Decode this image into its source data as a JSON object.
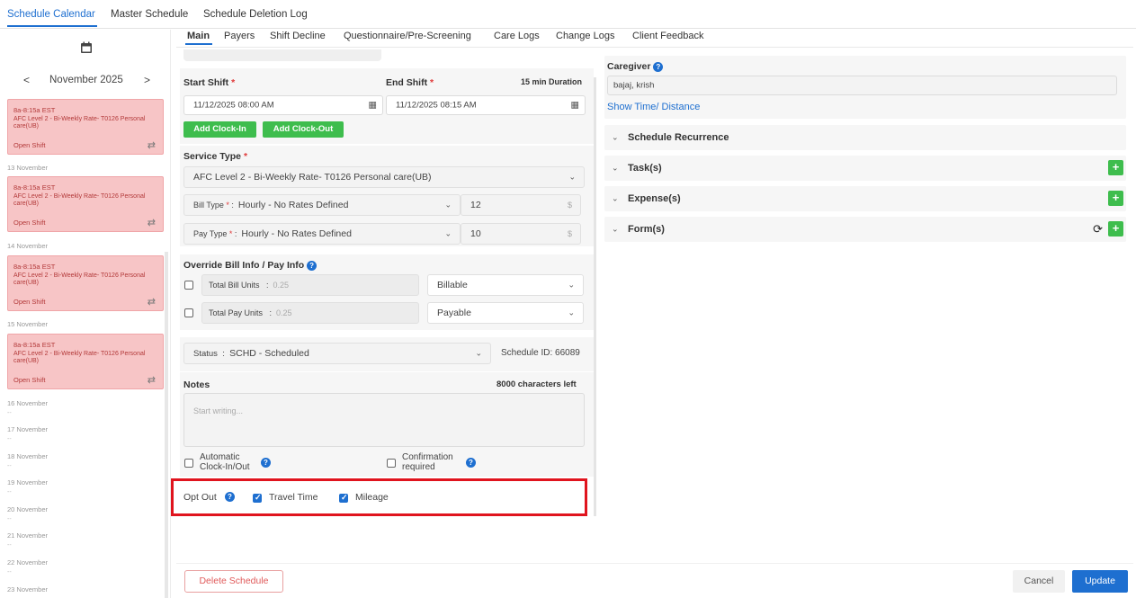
{
  "top_tabs": [
    "Schedule Calendar",
    "Master Schedule",
    "Schedule Deletion Log"
  ],
  "calendar": {
    "month": "November 2025",
    "prev": "<",
    "next": ">",
    "cards": [
      {
        "time": "8a-8:15a EST",
        "service": "AFC Level 2 - Bi-Weekly Rate- T0126 Personal care(UB)",
        "status": "Open Shift"
      },
      {
        "time": "8a-8:15a EST",
        "service": "AFC Level 2 - Bi-Weekly Rate- T0126 Personal care(UB)",
        "status": "Open Shift"
      },
      {
        "time": "8a-8:15a EST",
        "service": "AFC Level 2 - Bi-Weekly Rate- T0126 Personal care(UB)",
        "status": "Open Shift"
      },
      {
        "time": "8a-8:15a EST",
        "service": "AFC Level 2 - Bi-Weekly Rate- T0126 Personal care(UB)",
        "status": "Open Shift"
      }
    ],
    "day_labels": [
      "13 November",
      "14 November",
      "15 November",
      "16 November",
      "17 November",
      "18 November",
      "19 November",
      "20 November",
      "21 November",
      "22 November",
      "23 November"
    ],
    "empty_marker": "--"
  },
  "sub_tabs": [
    "Main",
    "Payers",
    "Shift Decline",
    "Questionnaire/Pre-Screening",
    "Care Logs",
    "Change Logs",
    "Client Feedback"
  ],
  "shift": {
    "start_label": "Start Shift",
    "end_label": "End Shift",
    "required_mark": "*",
    "duration": "15 min Duration",
    "start_value": "11/12/2025 08:00 AM",
    "end_value": "11/12/2025 08:15 AM",
    "clock_in": "Add Clock-In",
    "clock_out": "Add Clock-Out"
  },
  "service": {
    "label": "Service Type",
    "value": "AFC Level 2 - Bi-Weekly Rate- T0126 Personal care(UB)",
    "bill_type_label": "Bill Type",
    "bill_type_value": "Hourly - No Rates Defined",
    "bill_rate": "12",
    "pay_type_label": "Pay Type",
    "pay_type_value": "Hourly - No Rates Defined",
    "pay_rate": "10",
    "currency": "$"
  },
  "override": {
    "label": "Override Bill Info / Pay Info",
    "bill_units_label": "Total Bill Units",
    "bill_units_value": "0.25",
    "bill_select": "Billable",
    "pay_units_label": "Total Pay Units",
    "pay_units_value": "0.25",
    "pay_select": "Payable"
  },
  "status": {
    "label": "Status",
    "value": "SCHD - Scheduled",
    "schedule_id": "Schedule ID: 66089"
  },
  "notes": {
    "label": "Notes",
    "remaining": "8000 characters left",
    "placeholder": "Start writing..."
  },
  "options": {
    "auto_clock_line1": "Automatic",
    "auto_clock_line2": "Clock-In/Out",
    "confirm_line1": "Confirmation",
    "confirm_line2": "required",
    "opt_out": "Opt Out",
    "travel_time": "Travel Time",
    "mileage": "Mileage"
  },
  "caregiver": {
    "label": "Caregiver",
    "value": "bajaj, krish",
    "link": "Show Time/ Distance"
  },
  "sections": [
    "Schedule Recurrence",
    "Task(s)",
    "Expense(s)",
    "Form(s)"
  ],
  "buttons": {
    "delete": "Delete Schedule",
    "cancel": "Cancel",
    "update": "Update"
  },
  "colors": {
    "accent": "#1e6fd0",
    "green": "#3ebd4d",
    "card_bg": "#f7c5c6",
    "highlight": "#e0141e"
  }
}
